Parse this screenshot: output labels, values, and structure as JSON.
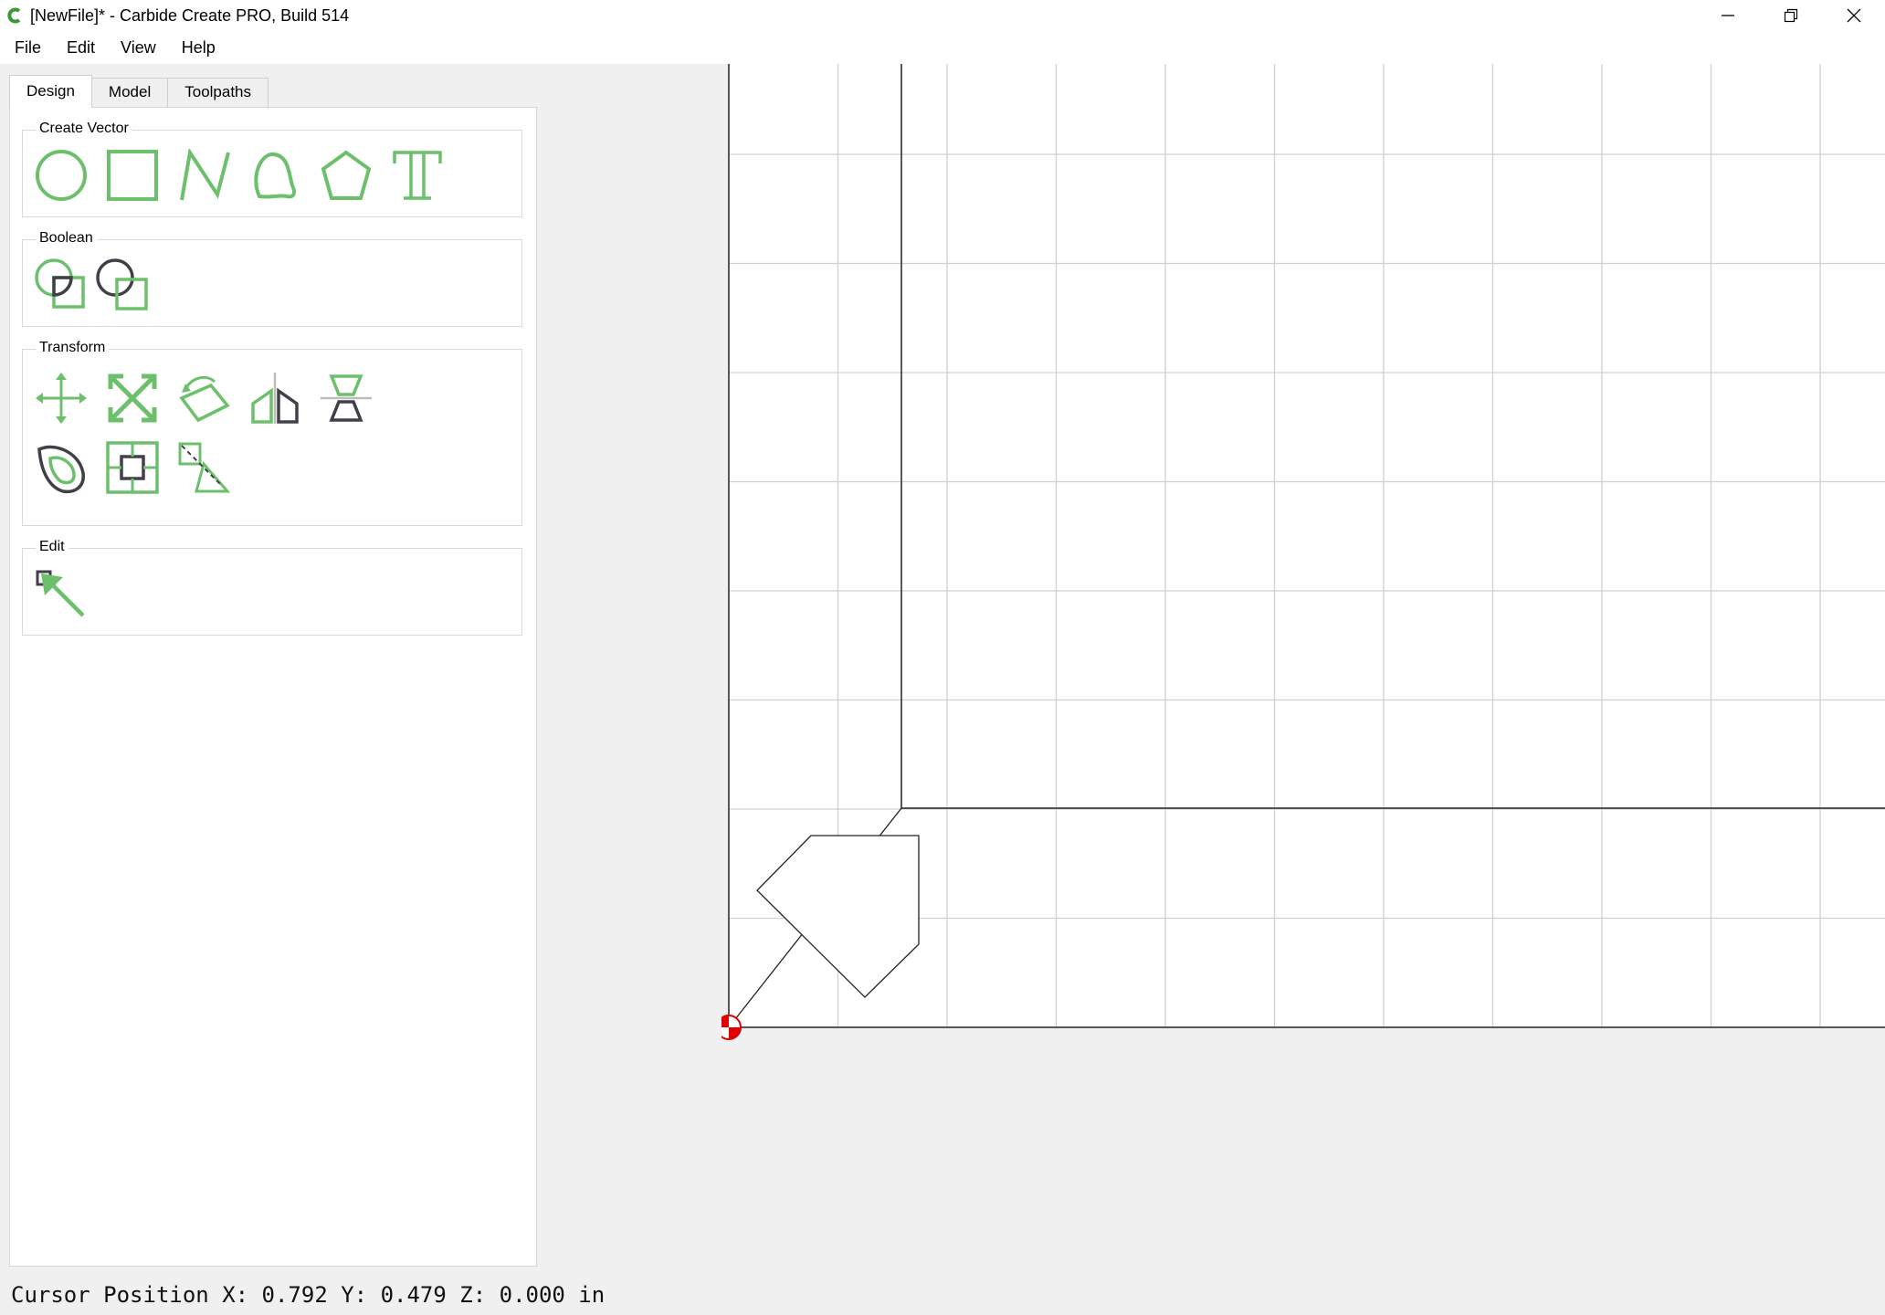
{
  "window": {
    "title": "[NewFile]* - Carbide Create PRO, Build 514",
    "app_icon": "carbide-c-icon",
    "controls": [
      "minimize-icon",
      "restore-icon",
      "close-icon"
    ]
  },
  "menu": {
    "items": [
      {
        "label": "File"
      },
      {
        "label": "Edit"
      },
      {
        "label": "View"
      },
      {
        "label": "Help"
      }
    ]
  },
  "tabs": [
    {
      "label": "Design",
      "active": true
    },
    {
      "label": "Model",
      "active": false
    },
    {
      "label": "Toolpaths",
      "active": false
    }
  ],
  "groups": {
    "create_vector": {
      "label": "Create Vector",
      "tools": [
        "circle-icon",
        "rectangle-icon",
        "polyline-icon",
        "curve-icon",
        "polygon-icon",
        "text-icon"
      ]
    },
    "boolean": {
      "label": "Boolean",
      "tools": [
        "boolean-subtract-icon",
        "boolean-union-icon"
      ]
    },
    "transform": {
      "label": "Transform",
      "tools": [
        "move-icon",
        "scale-icon",
        "rotate-icon",
        "mirror-horizontal-icon",
        "mirror-vertical-icon",
        "offset-icon",
        "align-icon",
        "size-icon"
      ]
    },
    "edit": {
      "label": "Edit",
      "tools": [
        "node-edit-icon"
      ]
    }
  },
  "colors": {
    "accent_green": "#6cc06c",
    "dark_gray": "#404048",
    "origin_red": "#e00000",
    "grid": "#d0d0d0"
  },
  "status": {
    "text": "Cursor Position X: 0.792 Y: 0.479 Z: 0.000 in"
  }
}
